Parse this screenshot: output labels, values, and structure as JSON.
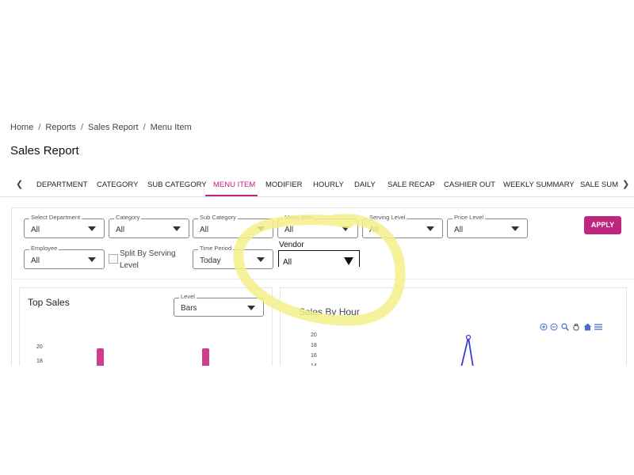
{
  "breadcrumb": [
    "Home",
    "Reports",
    "Sales Report",
    "Menu Item"
  ],
  "page_title": "Sales Report",
  "tabs": [
    "DEPARTMENT",
    "CATEGORY",
    "SUB CATEGORY",
    "MENU ITEM",
    "MODIFIER",
    "HOURLY",
    "DAILY",
    "SALE RECAP",
    "CASHIER OUT",
    "WEEKLY SUMMARY",
    "SALE SUMM"
  ],
  "active_tab": "MENU ITEM",
  "filters": {
    "department": {
      "label": "Select Department",
      "value": "All"
    },
    "category": {
      "label": "Category",
      "value": "All"
    },
    "sub_category": {
      "label": "Sub Category",
      "value": "All"
    },
    "menu_item": {
      "label": "Menu Item",
      "value": "All"
    },
    "serving_level": {
      "label": "Serving Level",
      "value": "All"
    },
    "price_level": {
      "label": "Price Level",
      "value": "All"
    },
    "employee": {
      "label": "Employee",
      "value": "All"
    },
    "split_by_serving_level": {
      "label": "Split By Serving Level",
      "checked": false
    },
    "time_period": {
      "label": "Time Period",
      "value": "Today"
    },
    "vendor": {
      "label": "Vendor",
      "value": "All"
    }
  },
  "apply_label": "APPLY",
  "top_sales": {
    "title": "Top Sales",
    "level": {
      "label": "Level",
      "value": "Bars"
    },
    "y_ticks": [
      "20",
      "18"
    ]
  },
  "sales_by_hour": {
    "title": "Sales By Hour",
    "y_ticks": [
      "20",
      "18",
      "16",
      "14"
    ]
  },
  "toolbar_icons": [
    "zoom-in-icon",
    "zoom-out-icon",
    "magnifier-icon",
    "pan-icon",
    "home-icon",
    "menu-icon"
  ],
  "colors": {
    "accent": "#c0257f",
    "bar": "#d03d8f",
    "line": "#3b3bd6",
    "highlight": "#f4f08a"
  }
}
